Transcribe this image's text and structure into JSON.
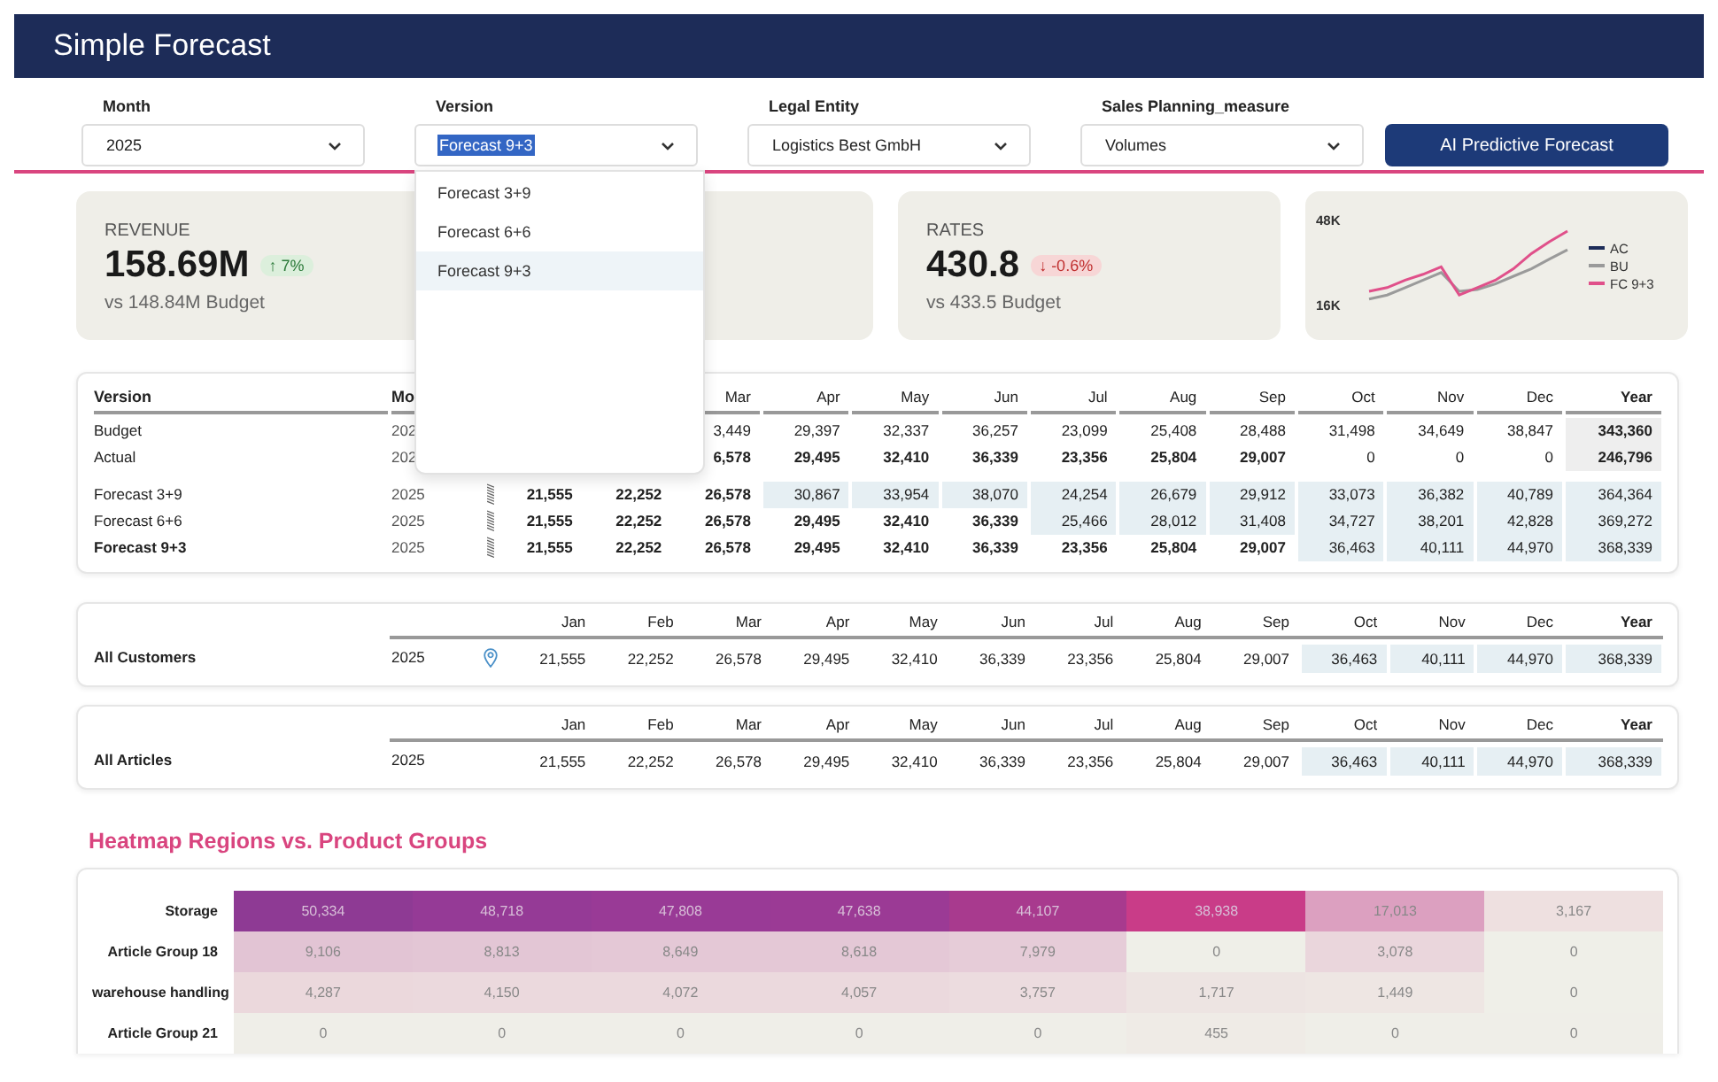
{
  "header": {
    "title": "Simple Forecast"
  },
  "filters": [
    {
      "label": "Month",
      "value": "2025",
      "text_selected": false
    },
    {
      "label": "Version",
      "value": "Forecast 9+3",
      "text_selected": true
    },
    {
      "label": "Legal Entity",
      "value": "Logistics Best GmbH",
      "text_selected": false
    },
    {
      "label": "Sales Planning_measure",
      "value": "Volumes",
      "text_selected": false
    }
  ],
  "action_button": "AI Predictive Forecast",
  "version_dropdown": [
    {
      "label": "Forecast 3+9",
      "selected": false
    },
    {
      "label": "Forecast 6+6",
      "selected": false
    },
    {
      "label": "Forecast 9+3",
      "selected": true
    }
  ],
  "kpis": [
    {
      "kind": "metric",
      "title": "REVENUE",
      "value": "158.69M",
      "change": "↑ 7%",
      "positive": true,
      "comparison": "vs 148.84M Budget"
    },
    {
      "kind": "hidden"
    },
    {
      "kind": "metric",
      "title": "RATES",
      "value": "430.8",
      "change": "↓ -0.6%",
      "positive": false,
      "comparison": "vs 433.5 Budget"
    },
    {
      "kind": "chart",
      "chart_data": {
        "type": "line",
        "legend": "right",
        "yticks": [
          {
            "value": 16000,
            "label": "16K"
          },
          {
            "value": 48000,
            "label": "48K"
          }
        ],
        "ylim": [
          16000,
          48000
        ],
        "series": [
          {
            "name": "AC",
            "color": "#1d2c58",
            "values": [
              null,
              null,
              null,
              null,
              null,
              null,
              null,
              null,
              null,
              null,
              null,
              null
            ]
          },
          {
            "name": "BU",
            "color": "#9a9a9a",
            "values": [
              18100,
              19600,
              22400,
              25200,
              28100,
              21000,
              21700,
              23800,
              26700,
              29500,
              33100,
              36600
            ]
          },
          {
            "name": "FC 9+3",
            "color": "#e0508a",
            "values": [
              21000,
              22400,
              25200,
              27400,
              30200,
              19600,
              22400,
              25200,
              29500,
              35200,
              39700,
              43700
            ]
          }
        ]
      }
    }
  ],
  "main_table": {
    "row_header_columns": [
      "Version",
      "Mo"
    ],
    "columns": [
      null,
      null,
      "Mar",
      "Apr",
      "May",
      "Jun",
      "Jul",
      "Aug",
      "Sep",
      "Oct",
      "Nov",
      "Dec",
      "Year"
    ],
    "rows": [
      {
        "version": "Budget",
        "bold": false,
        "month": "202",
        "grip": false,
        "cells": [
          null,
          null,
          {
            "text": "3,449",
            "bold": false,
            "highlighted": false
          },
          {
            "text": "29,397",
            "bold": false,
            "highlighted": false
          },
          {
            "text": "32,337",
            "bold": false,
            "highlighted": false
          },
          {
            "text": "36,257",
            "bold": false,
            "highlighted": false
          },
          {
            "text": "23,099",
            "bold": false,
            "highlighted": false
          },
          {
            "text": "25,408",
            "bold": false,
            "highlighted": false
          },
          {
            "text": "28,488",
            "bold": false,
            "highlighted": false
          },
          {
            "text": "31,498",
            "bold": false,
            "highlighted": false
          },
          {
            "text": "34,649",
            "bold": false,
            "highlighted": false
          },
          {
            "text": "38,847",
            "bold": false,
            "highlighted": false
          },
          {
            "text": "343,360",
            "bold": true,
            "highlighted": false
          }
        ]
      },
      {
        "version": "Actual",
        "bold": false,
        "month": "202",
        "grip": false,
        "cells": [
          null,
          null,
          {
            "text": "6,578",
            "bold": true,
            "highlighted": false
          },
          {
            "text": "29,495",
            "bold": true,
            "highlighted": false
          },
          {
            "text": "32,410",
            "bold": true,
            "highlighted": false
          },
          {
            "text": "36,339",
            "bold": true,
            "highlighted": false
          },
          {
            "text": "23,356",
            "bold": true,
            "highlighted": false
          },
          {
            "text": "25,804",
            "bold": true,
            "highlighted": false
          },
          {
            "text": "29,007",
            "bold": true,
            "highlighted": false
          },
          {
            "text": "0",
            "bold": false,
            "highlighted": false
          },
          {
            "text": "0",
            "bold": false,
            "highlighted": false
          },
          {
            "text": "0",
            "bold": false,
            "highlighted": false
          },
          {
            "text": "246,796",
            "bold": true,
            "highlighted": false
          }
        ]
      },
      {
        "version": "Forecast 3+9",
        "bold": false,
        "month": "2025",
        "grip": true,
        "cells": [
          {
            "text": "21,555",
            "bold": true,
            "highlighted": false
          },
          {
            "text": "22,252",
            "bold": true,
            "highlighted": false
          },
          {
            "text": "26,578",
            "bold": true,
            "highlighted": false
          },
          {
            "text": "30,867",
            "bold": false,
            "highlighted": true
          },
          {
            "text": "33,954",
            "bold": false,
            "highlighted": true
          },
          {
            "text": "38,070",
            "bold": false,
            "highlighted": true
          },
          {
            "text": "24,254",
            "bold": false,
            "highlighted": true
          },
          {
            "text": "26,679",
            "bold": false,
            "highlighted": true
          },
          {
            "text": "29,912",
            "bold": false,
            "highlighted": true
          },
          {
            "text": "33,073",
            "bold": false,
            "highlighted": true
          },
          {
            "text": "36,382",
            "bold": false,
            "highlighted": true
          },
          {
            "text": "40,789",
            "bold": false,
            "highlighted": true
          },
          {
            "text": "364,364",
            "bold": false,
            "highlighted": true
          }
        ]
      },
      {
        "version": "Forecast 6+6",
        "bold": false,
        "month": "2025",
        "grip": true,
        "cells": [
          {
            "text": "21,555",
            "bold": true,
            "highlighted": false
          },
          {
            "text": "22,252",
            "bold": true,
            "highlighted": false
          },
          {
            "text": "26,578",
            "bold": true,
            "highlighted": false
          },
          {
            "text": "29,495",
            "bold": true,
            "highlighted": false
          },
          {
            "text": "32,410",
            "bold": true,
            "highlighted": false
          },
          {
            "text": "36,339",
            "bold": true,
            "highlighted": false
          },
          {
            "text": "25,466",
            "bold": false,
            "highlighted": true
          },
          {
            "text": "28,012",
            "bold": false,
            "highlighted": true
          },
          {
            "text": "31,408",
            "bold": false,
            "highlighted": true
          },
          {
            "text": "34,727",
            "bold": false,
            "highlighted": true
          },
          {
            "text": "38,201",
            "bold": false,
            "highlighted": true
          },
          {
            "text": "42,828",
            "bold": false,
            "highlighted": true
          },
          {
            "text": "369,272",
            "bold": false,
            "highlighted": true
          }
        ]
      },
      {
        "version": "Forecast 9+3",
        "bold": true,
        "month": "2025",
        "grip": true,
        "cells": [
          {
            "text": "21,555",
            "bold": true,
            "highlighted": false
          },
          {
            "text": "22,252",
            "bold": true,
            "highlighted": false
          },
          {
            "text": "26,578",
            "bold": true,
            "highlighted": false
          },
          {
            "text": "29,495",
            "bold": true,
            "highlighted": false
          },
          {
            "text": "32,410",
            "bold": true,
            "highlighted": false
          },
          {
            "text": "36,339",
            "bold": true,
            "highlighted": false
          },
          {
            "text": "23,356",
            "bold": true,
            "highlighted": false
          },
          {
            "text": "25,804",
            "bold": true,
            "highlighted": false
          },
          {
            "text": "29,007",
            "bold": true,
            "highlighted": false
          },
          {
            "text": "36,463",
            "bold": false,
            "highlighted": true
          },
          {
            "text": "40,111",
            "bold": false,
            "highlighted": true
          },
          {
            "text": "44,970",
            "bold": false,
            "highlighted": true
          },
          {
            "text": "368,339",
            "bold": false,
            "highlighted": true
          }
        ]
      }
    ]
  },
  "summary_tables": [
    {
      "label": "All Customers",
      "year": "2025",
      "pin": true,
      "columns": [
        "Jan",
        "Feb",
        "Mar",
        "Apr",
        "May",
        "Jun",
        "Jul",
        "Aug",
        "Sep",
        "Oct",
        "Nov",
        "Dec",
        "Year"
      ],
      "cells": [
        {
          "text": "21,555",
          "highlighted": false
        },
        {
          "text": "22,252",
          "highlighted": false
        },
        {
          "text": "26,578",
          "highlighted": false
        },
        {
          "text": "29,495",
          "highlighted": false
        },
        {
          "text": "32,410",
          "highlighted": false
        },
        {
          "text": "36,339",
          "highlighted": false
        },
        {
          "text": "23,356",
          "highlighted": false
        },
        {
          "text": "25,804",
          "highlighted": false
        },
        {
          "text": "29,007",
          "highlighted": false
        },
        {
          "text": "36,463",
          "highlighted": true
        },
        {
          "text": "40,111",
          "highlighted": true
        },
        {
          "text": "44,970",
          "highlighted": true
        },
        {
          "text": "368,339",
          "highlighted": true
        }
      ]
    },
    {
      "label": "All Articles",
      "year": "2025",
      "pin": false,
      "columns": [
        "Jan",
        "Feb",
        "Mar",
        "Apr",
        "May",
        "Jun",
        "Jul",
        "Aug",
        "Sep",
        "Oct",
        "Nov",
        "Dec",
        "Year"
      ],
      "cells": [
        {
          "text": "21,555",
          "highlighted": false
        },
        {
          "text": "22,252",
          "highlighted": false
        },
        {
          "text": "26,578",
          "highlighted": false
        },
        {
          "text": "29,495",
          "highlighted": false
        },
        {
          "text": "32,410",
          "highlighted": false
        },
        {
          "text": "36,339",
          "highlighted": false
        },
        {
          "text": "23,356",
          "highlighted": false
        },
        {
          "text": "25,804",
          "highlighted": false
        },
        {
          "text": "29,007",
          "highlighted": false
        },
        {
          "text": "36,463",
          "highlighted": true
        },
        {
          "text": "40,111",
          "highlighted": true
        },
        {
          "text": "44,970",
          "highlighted": true
        },
        {
          "text": "368,339",
          "highlighted": true
        }
      ]
    }
  ],
  "heatmap": {
    "title": "Heatmap Regions vs. Product Groups",
    "rows": [
      {
        "label": "Storage",
        "cells": [
          {
            "text": "50,334",
            "color": "#8e3a94"
          },
          {
            "text": "48,718",
            "color": "#953a96"
          },
          {
            "text": "47,808",
            "color": "#993a96"
          },
          {
            "text": "47,638",
            "color": "#9b3a95"
          },
          {
            "text": "44,107",
            "color": "#a83a8e"
          },
          {
            "text": "38,938",
            "color": "#c93c88"
          },
          {
            "text": "17,013",
            "color": "#dca0c0"
          },
          {
            "text": "3,167",
            "color": "#eee0e0"
          }
        ]
      },
      {
        "label": "Article Group 18",
        "cells": [
          {
            "text": "9,106",
            "color": "#e2c4d4"
          },
          {
            "text": "8,813",
            "color": "#e3c6d5"
          },
          {
            "text": "8,649",
            "color": "#e4c8d6"
          },
          {
            "text": "8,618",
            "color": "#e4c8d6"
          },
          {
            "text": "7,979",
            "color": "#e6ccd8"
          },
          {
            "text": "0",
            "color": "#efefe8"
          },
          {
            "text": "3,078",
            "color": "#ead6dc"
          },
          {
            "text": "0",
            "color": "#efefe8"
          }
        ]
      },
      {
        "label": "warehouse handling",
        "cells": [
          {
            "text": "4,287",
            "color": "#ebd8dc"
          },
          {
            "text": "4,150",
            "color": "#ebd9dd"
          },
          {
            "text": "4,072",
            "color": "#ebd9dd"
          },
          {
            "text": "4,057",
            "color": "#ebd9dd"
          },
          {
            "text": "3,757",
            "color": "#ecdcdf"
          },
          {
            "text": "1,717",
            "color": "#ede4e2"
          },
          {
            "text": "1,449",
            "color": "#eee6e3"
          },
          {
            "text": "0",
            "color": "#efefe8"
          }
        ]
      },
      {
        "label": "Article Group 21",
        "cells": [
          {
            "text": "0",
            "color": "#efeee8"
          },
          {
            "text": "0",
            "color": "#efeee8"
          },
          {
            "text": "0",
            "color": "#efeee8"
          },
          {
            "text": "0",
            "color": "#efeee8"
          },
          {
            "text": "0",
            "color": "#efeee8"
          },
          {
            "text": "455",
            "color": "#efebe6"
          },
          {
            "text": "0",
            "color": "#efeee8"
          },
          {
            "text": "0",
            "color": "#efeee8"
          }
        ]
      }
    ]
  }
}
